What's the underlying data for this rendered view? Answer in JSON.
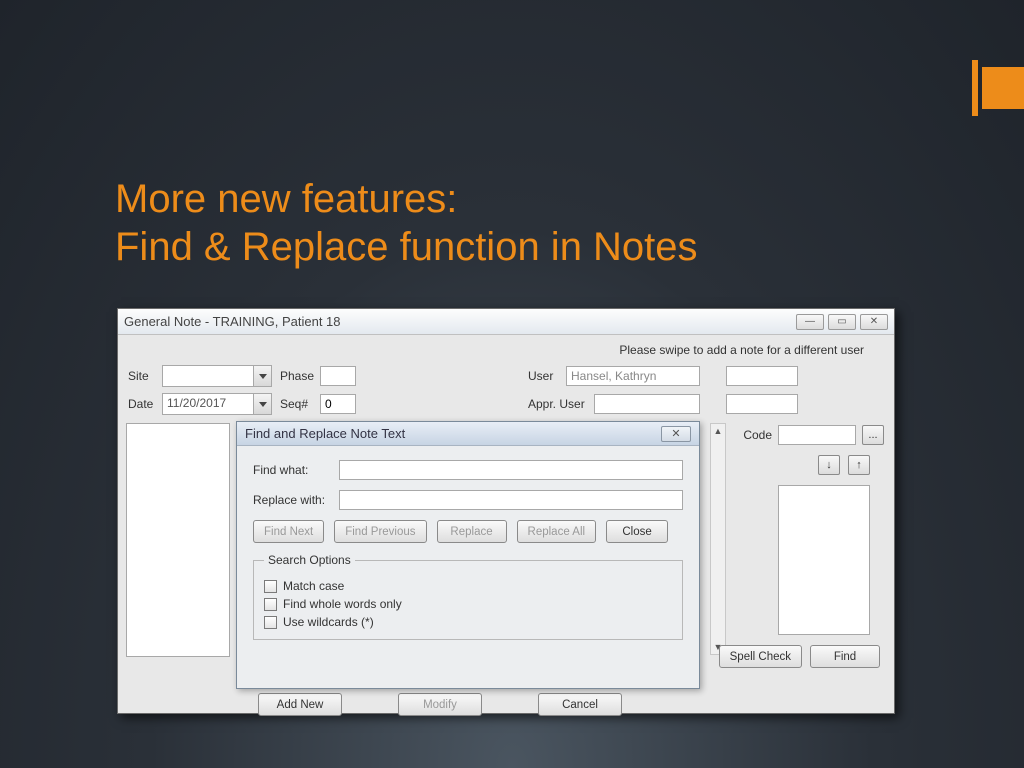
{
  "slide": {
    "title_line1": "More  new features:",
    "title_line2": "Find & Replace function in Notes"
  },
  "window": {
    "title": "General Note - TRAINING, Patient 18",
    "swipe_msg": "Please swipe to add a note for a different user",
    "labels": {
      "site": "Site",
      "phase": "Phase",
      "date": "Date",
      "seq": "Seq#",
      "user": "User",
      "appr_user": "Appr. User",
      "code": "Code"
    },
    "values": {
      "date": "11/20/2017",
      "seq": "0",
      "user": "Hansel, Kathryn"
    },
    "buttons": {
      "add_new": "Add New",
      "modify": "Modify",
      "cancel": "Cancel",
      "spell_check": "Spell Check",
      "find": "Find",
      "ellipsis": "..."
    }
  },
  "dialog": {
    "title": "Find and Replace Note Text",
    "find_what": "Find what:",
    "replace_with": "Replace with:",
    "buttons": {
      "find_next": "Find Next",
      "find_prev": "Find Previous",
      "replace": "Replace",
      "replace_all": "Replace All",
      "close": "Close"
    },
    "options_legend": "Search Options",
    "options": {
      "match_case": "Match case",
      "whole_words": "Find whole words only",
      "wildcards": "Use wildcards (*)"
    }
  }
}
